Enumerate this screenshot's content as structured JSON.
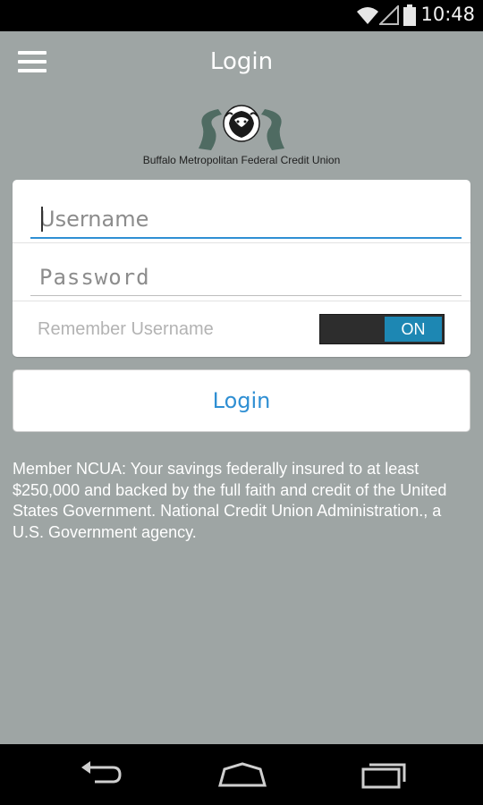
{
  "status_bar": {
    "time": "10:48",
    "icons": [
      "wifi-icon",
      "signal-icon",
      "battery-icon"
    ]
  },
  "app_bar": {
    "title": "Login",
    "menu_icon": "hamburger-menu-icon"
  },
  "logo": {
    "text": "Buffalo Metropolitan Federal Credit Union",
    "mark_icon": "buffalo-logo-icon"
  },
  "login_form": {
    "username": {
      "value": "",
      "placeholder": "Username"
    },
    "password": {
      "value": "",
      "placeholder": "Password"
    },
    "remember_label": "Remember Username",
    "remember_toggle": "ON",
    "login_button": "Login"
  },
  "disclaimer": "Member NCUA: Your savings federally insured to at least $250,000 and backed by the full faith and credit of the United States Government. National Credit Union Administration., a U.S. Government agency.",
  "nav_bar": {
    "icons": [
      "back-icon",
      "home-icon",
      "recents-icon"
    ]
  },
  "colors": {
    "background": "#9ea5a4",
    "accent": "#2f8fd3",
    "toggle_on": "#1d87b3",
    "logo_green": "#4f6b62"
  }
}
